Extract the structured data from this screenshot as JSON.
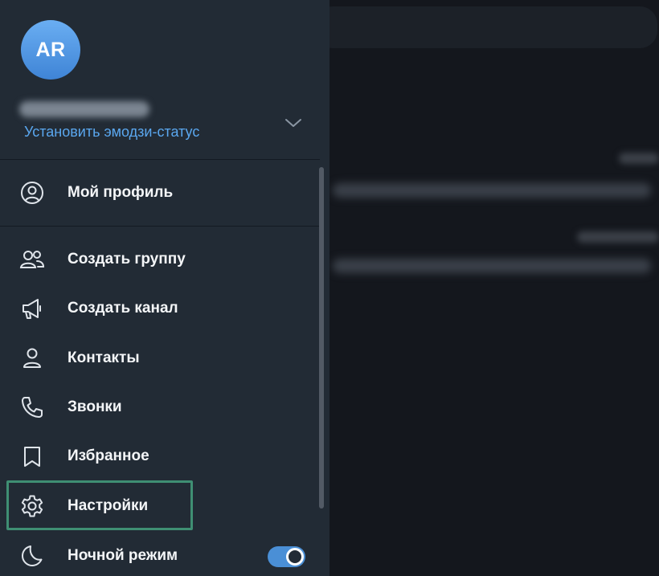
{
  "profile": {
    "avatar_initials": "AR",
    "emoji_status_link": "Установить эмодзи-статус"
  },
  "menu": {
    "my_profile": "Мой профиль",
    "create_group": "Создать группу",
    "create_channel": "Создать канал",
    "contacts": "Контакты",
    "calls": "Звонки",
    "saved": "Избранное",
    "settings": "Настройки",
    "night_mode": "Ночной режим"
  },
  "night_mode_enabled": true,
  "colors": {
    "accent": "#5aa7ef",
    "drawer_bg": "#222b35",
    "highlight_border": "#3f8f73",
    "toggle_on": "#4a8fd6"
  },
  "icons": {
    "my_profile": "user-circle-icon",
    "create_group": "users-icon",
    "create_channel": "megaphone-icon",
    "contacts": "user-icon",
    "calls": "phone-icon",
    "saved": "bookmark-icon",
    "settings": "gear-icon",
    "night_mode": "moon-icon",
    "expand": "chevron-down-icon"
  }
}
